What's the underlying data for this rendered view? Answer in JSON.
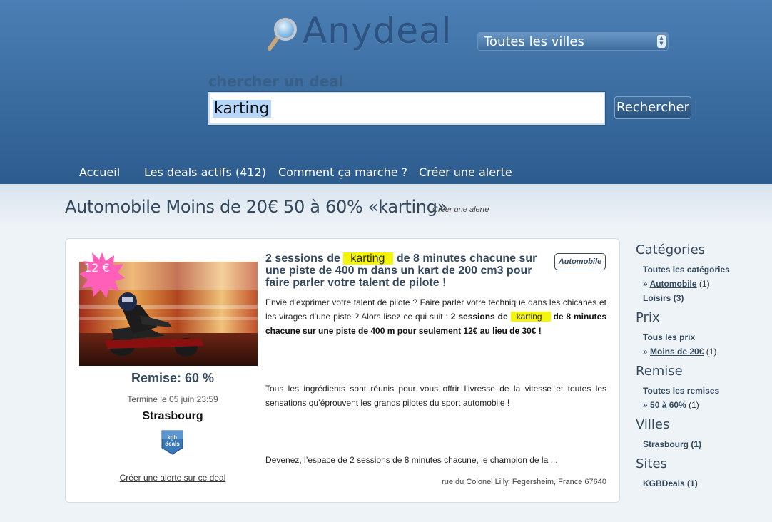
{
  "header": {
    "logo_text": "Anydeal",
    "city_select_value": "Toutes les villes",
    "search_label": "chercher un deal",
    "search_value": "karting",
    "search_button": "Rechercher",
    "nav": [
      "Accueil",
      "Les deals actifs (412)",
      "Comment ça marche ?",
      "Créer une alerte"
    ]
  },
  "page": {
    "title": "Automobile Moins de 20€ 50 à 60% «karting»",
    "create_alert": "Créer une alerte"
  },
  "deal": {
    "price": "12 €",
    "discount": "Remise: 60 %",
    "ends": "Termine le 05 juin 23:59",
    "city": "Strasbourg",
    "badge_line1": "kgb",
    "badge_line2": "deals",
    "alert_link": "Créer une alerte sur ce deal",
    "category_tag": "Automobile",
    "title_part1": "2 sessions de ",
    "title_highlight": "karting",
    "title_part2": " de 8 minutes chacune sur une piste de 400 m dans un kart de 200 cm3 pour faire parler votre talent de pilote !",
    "desc1_plain": "Envie d’exprimer votre talent de pilote ? Faire parler votre technique dans les chicanes et les virages d’une piste ? Alors lisez ce qui suit : ",
    "desc1_bold1": "2 sessions de ",
    "desc1_highlight": "karting",
    "desc1_bold2": " de 8 minutes chacune sur une piste de 400 m pour seulement 12€ au lieu de 30€ !",
    "desc2": "Tous les ingrédients sont réunis pour vous offrir l’ivresse de la vitesse et toutes les sensations qu’éprouvent les grands pilotes du sport automobile !",
    "desc3": "Devenez, l’espace de 2 sessions de 8 minutes chacune, le champion de la ...",
    "address": "rue du Colonel Lilly, Fegersheim, France 67640"
  },
  "sidebar": {
    "categories": {
      "title": "Catégories",
      "all": "Toutes les catégories",
      "selected_prefix": "» ",
      "selected": "Automobile",
      "selected_count": " (1)",
      "other": "Loisirs",
      "other_count": " (3)"
    },
    "prix": {
      "title": "Prix",
      "all": "Tous les prix",
      "selected_prefix": "» ",
      "selected": "Moins de 20€",
      "selected_count": " (1)"
    },
    "remise": {
      "title": "Remise",
      "all": "Toutes les remises",
      "selected_prefix": "» ",
      "selected": "50 à 60%",
      "selected_count": " (1)"
    },
    "villes": {
      "title": "Villes",
      "item": "Strasbourg",
      "item_count": " (1)"
    },
    "sites": {
      "title": "Sites",
      "item": "KGBDeals",
      "item_count": " (1)"
    }
  },
  "colors": {
    "header_blue": "#3d6fa3",
    "logo_blue": "#2c5382",
    "highlight_yellow": "#f5f50a",
    "price_pink": "#ff5fb9"
  }
}
